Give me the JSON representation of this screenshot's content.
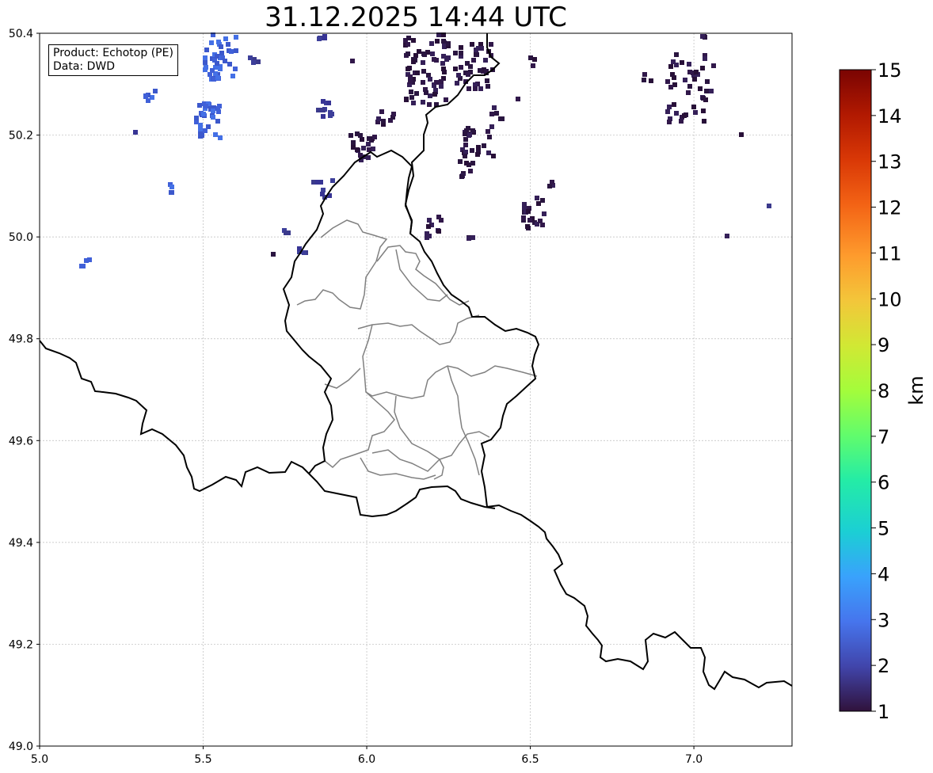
{
  "title": "31.12.2025 14:44 UTC",
  "info": {
    "product": "Product: Echotop (PE)",
    "source": "Data: DWD"
  },
  "map": {
    "lon_range": [
      5.0,
      7.3
    ],
    "lat_range": [
      49.0,
      50.4
    ],
    "lon_ticks": [
      "5.0",
      "5.5",
      "6.0",
      "6.5",
      "7.0"
    ],
    "lat_ticks": [
      "49.0",
      "49.2",
      "49.4",
      "49.6",
      "49.8",
      "50.0",
      "50.2",
      "50.4"
    ],
    "grid": true,
    "border_color": "#000000",
    "district_color": "#808080"
  },
  "colorbar": {
    "label": "km",
    "min": 1,
    "max": 15,
    "ticks": [
      "1",
      "2",
      "3",
      "4",
      "5",
      "6",
      "7",
      "8",
      "9",
      "10",
      "11",
      "12",
      "13",
      "14",
      "15"
    ],
    "colormap": "turbo"
  }
}
